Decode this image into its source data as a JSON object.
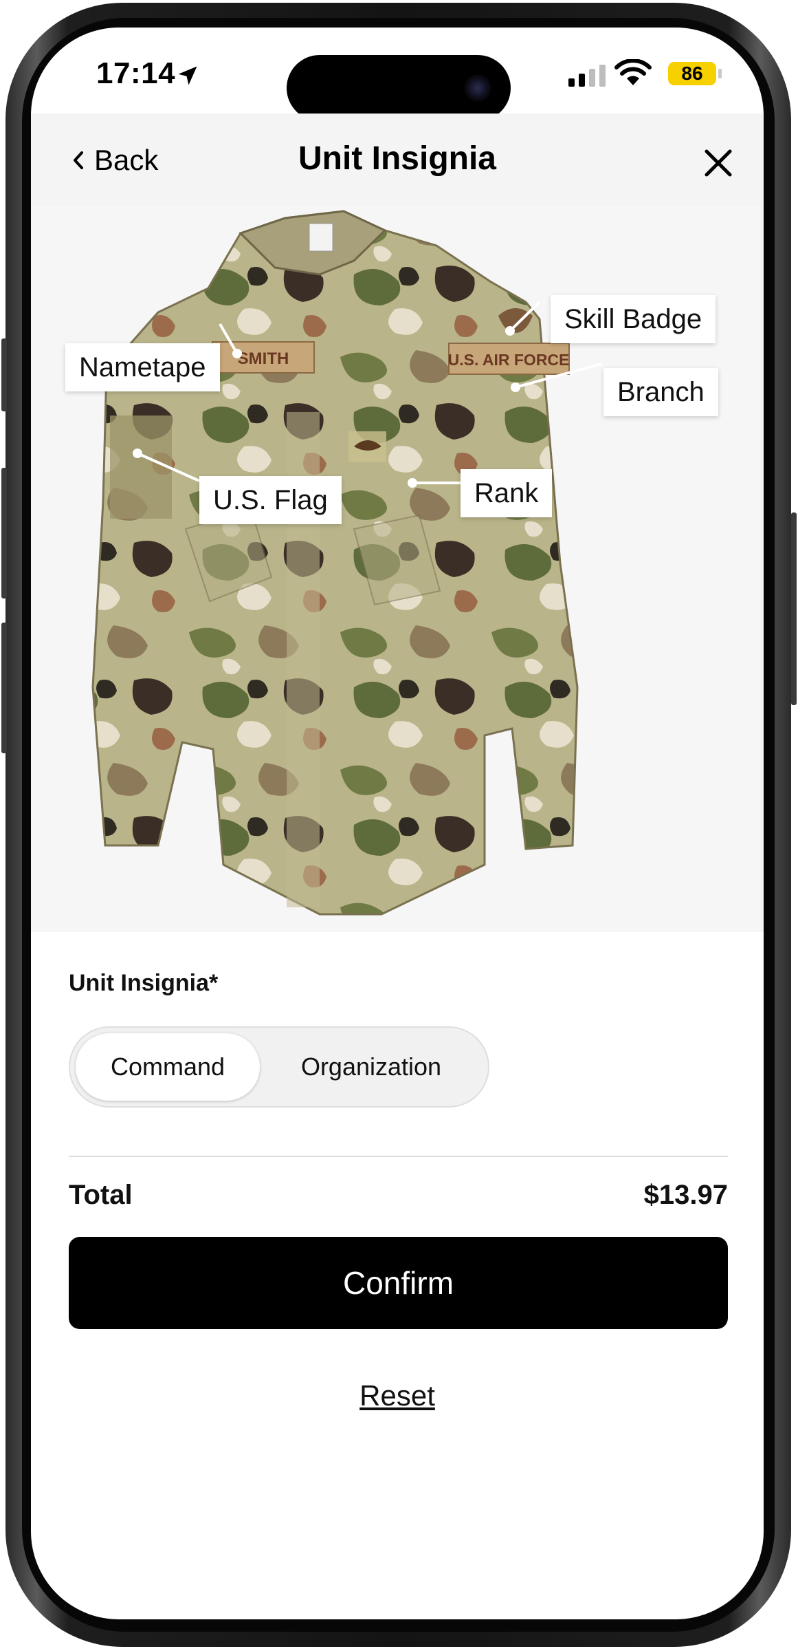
{
  "status_bar": {
    "time": "17:14",
    "battery_level": "86",
    "battery_color": "#f7d000"
  },
  "nav": {
    "back_label": "Back",
    "title": "Unit Insignia",
    "close_icon": "close-icon"
  },
  "hero": {
    "tags": {
      "nametape": "Nametape",
      "skill_badge": "Skill Badge",
      "branch": "Branch",
      "us_flag": "U.S. Flag",
      "rank": "Rank"
    },
    "patches": {
      "name": "SMITH",
      "branch": "U.S. AIR FORCE"
    }
  },
  "form": {
    "label": "Unit Insignia*",
    "options": [
      "Command",
      "Organization"
    ],
    "selected": "Command"
  },
  "summary": {
    "total_label": "Total",
    "total_value": "$13.97"
  },
  "actions": {
    "confirm_label": "Confirm",
    "reset_label": "Reset"
  }
}
